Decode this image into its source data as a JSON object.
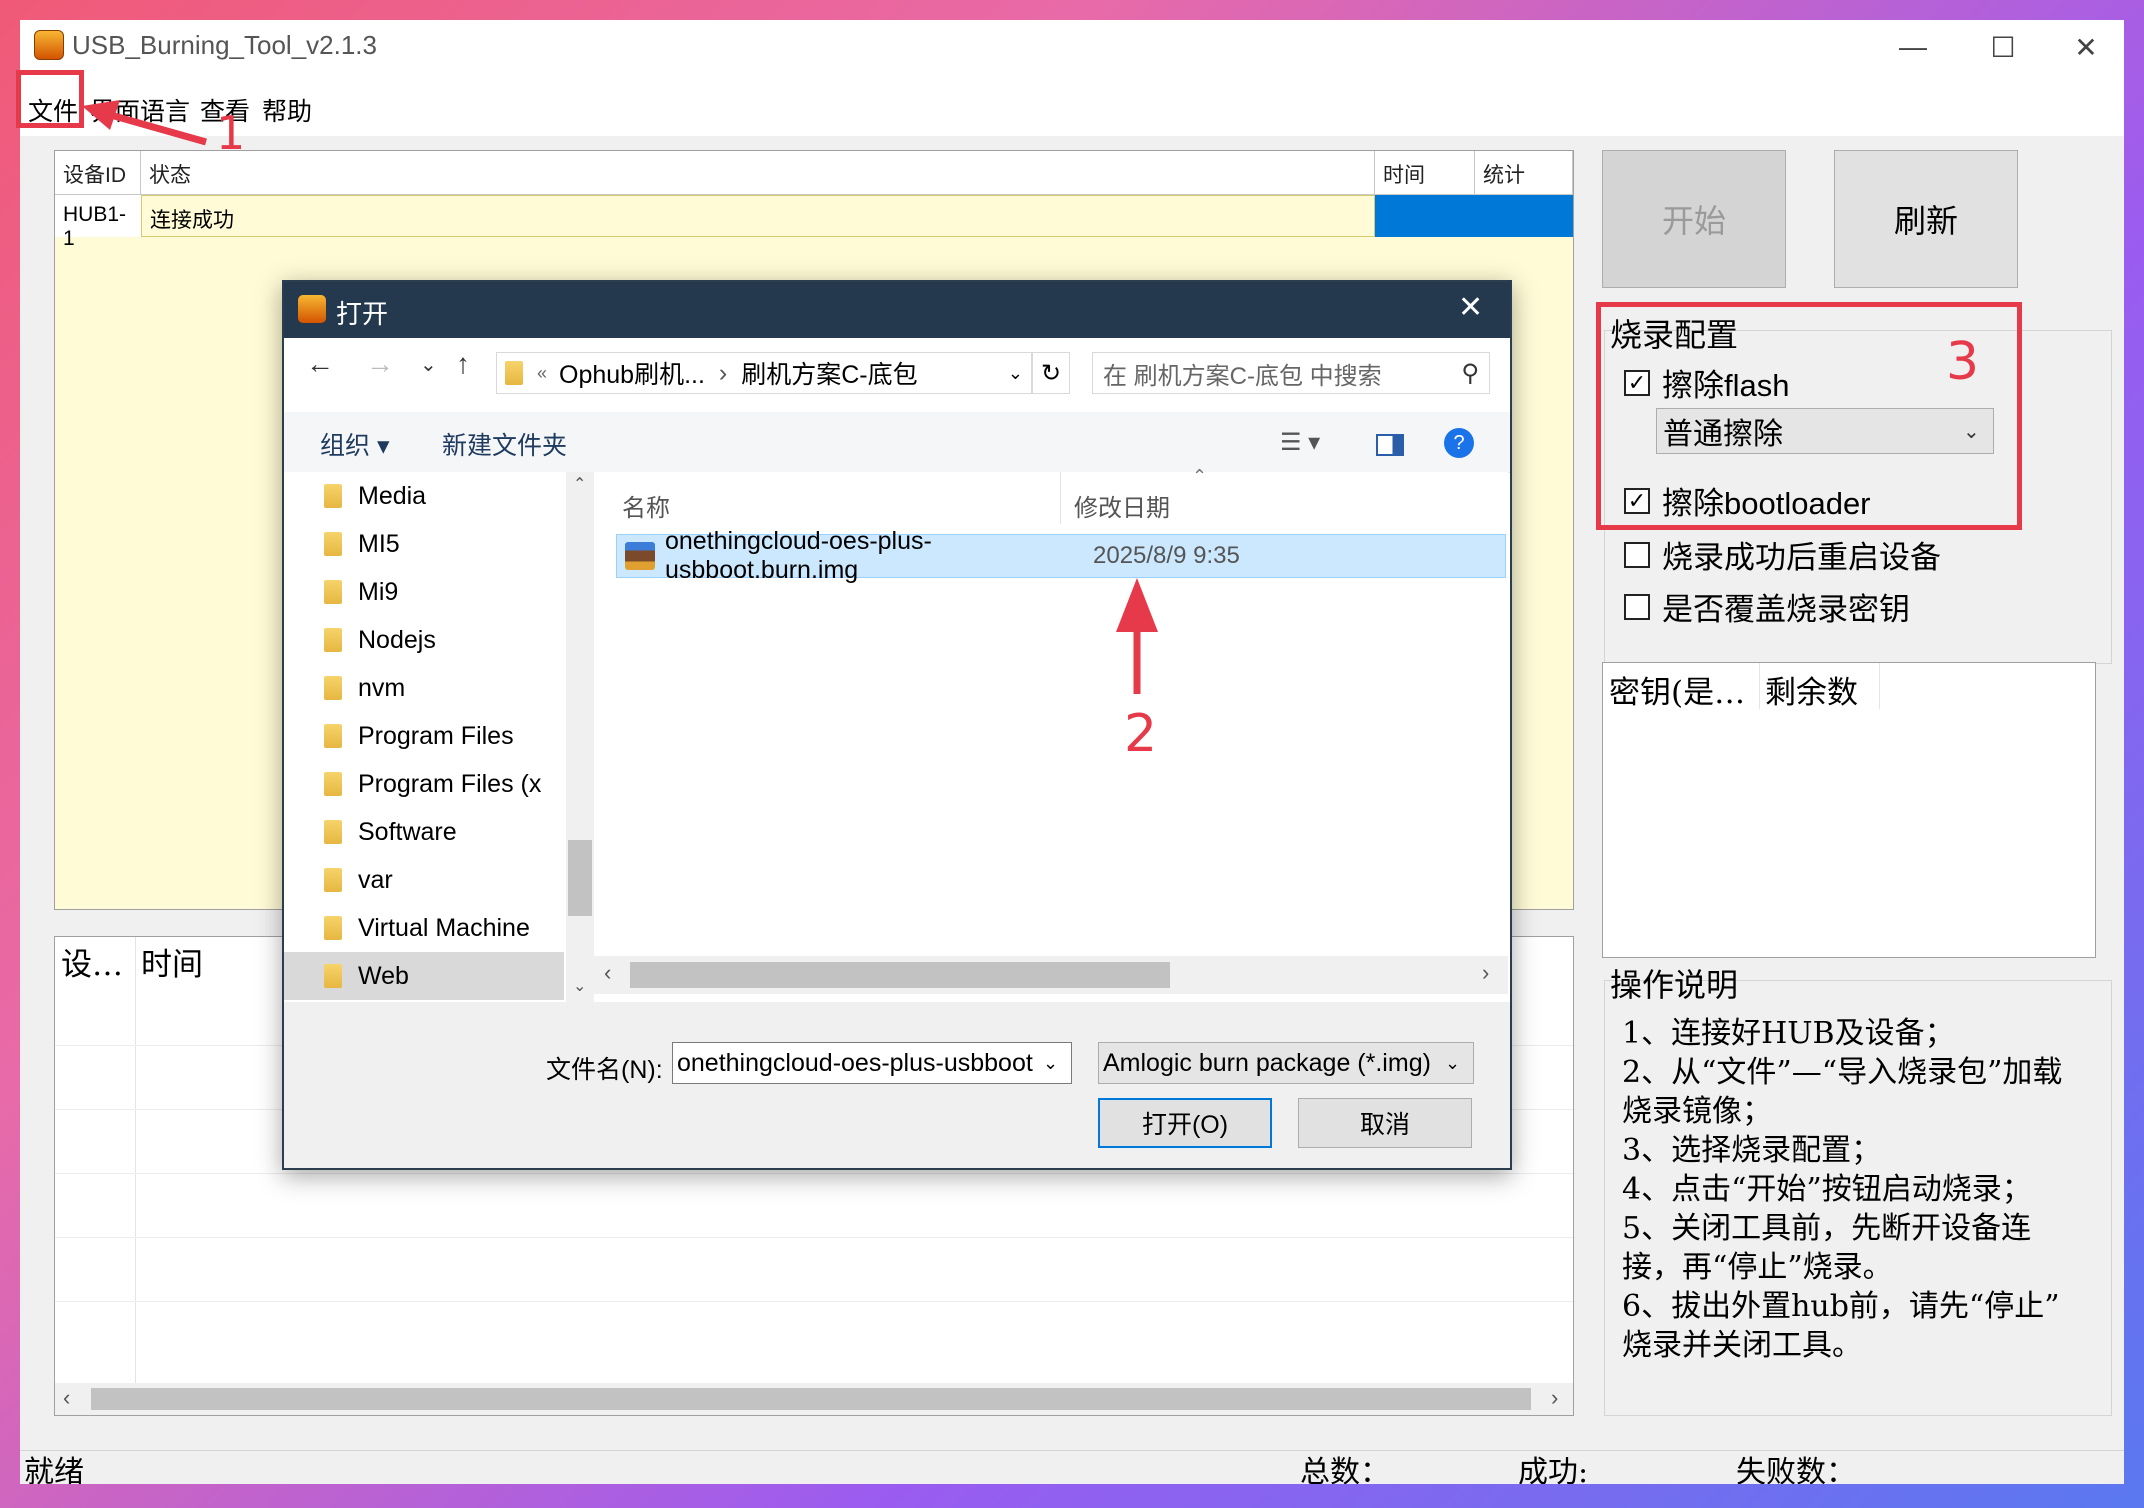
{
  "window": {
    "title": "USB_Burning_Tool_v2.1.3",
    "minimize_glyph": "—",
    "maximize_glyph": "☐",
    "close_glyph": "✕"
  },
  "menu": [
    "文件",
    "界面语言",
    "查看",
    "帮助"
  ],
  "device_table": {
    "headers": [
      "设备ID",
      "状态",
      "时间",
      "统计"
    ],
    "rows": [
      {
        "id": "HUB1-1",
        "status": "连接成功"
      }
    ]
  },
  "log_table": {
    "headers": [
      "设…",
      "时间"
    ]
  },
  "buttons": {
    "start": "开始",
    "refresh": "刷新"
  },
  "config": {
    "title": "烧录配置",
    "erase_flash": "擦除flash",
    "erase_mode": "普通擦除",
    "erase_bootloader": "擦除bootloader",
    "reboot_after": "烧录成功后重启设备",
    "overwrite_key": "是否覆盖烧录密钥"
  },
  "key_table": {
    "headers": [
      "密钥(是…",
      "剩余数"
    ]
  },
  "instructions": {
    "title": "操作说明",
    "lines": [
      "1、连接好HUB及设备；",
      "2、从“文件”—“导入烧录包”加载",
      "烧录镜像；",
      "3、选择烧录配置；",
      "4、点击“开始”按钮启动烧录；",
      "5、关闭工具前，先断开设备连",
      "接，再“停止”烧录。",
      "6、拔出外置hub前，请先“停止”",
      "烧录并关闭工具。"
    ]
  },
  "statusbar": {
    "ready": "就绪",
    "total": "总数：",
    "success": "成功:",
    "fail": "失败数："
  },
  "annotations": [
    "1",
    "2",
    "3"
  ],
  "dialog": {
    "title": "打开",
    "breadcrumb": [
      "«",
      "Ophub刷机...",
      "刷机方案C-底包"
    ],
    "search_placeholder": "在 刷机方案C-底包 中搜索",
    "organize": "组织",
    "new_folder": "新建文件夹",
    "sidebar": [
      "Media",
      "MI5",
      "Mi9",
      "Nodejs",
      "nvm",
      "Program Files",
      "Program Files (x",
      "Software",
      "var",
      "Virtual Machine",
      "Web"
    ],
    "columns": [
      "名称",
      "修改日期"
    ],
    "files": [
      {
        "name": "onethingcloud-oes-plus-usbboot.burn.img",
        "date": "2025/8/9 9:35"
      }
    ],
    "filename_label": "文件名(N):",
    "filename_value": "onethingcloud-oes-plus-usbboot",
    "filetype": "Amlogic burn package (*.img)",
    "open": "打开(O)",
    "cancel": "取消"
  },
  "colors": {
    "accent_red": "#e63a4a",
    "dialog_title": "#24394e",
    "selection": "#cce8ff",
    "progress_blue": "#0078d7",
    "row_yellow": "#fffbd6"
  }
}
